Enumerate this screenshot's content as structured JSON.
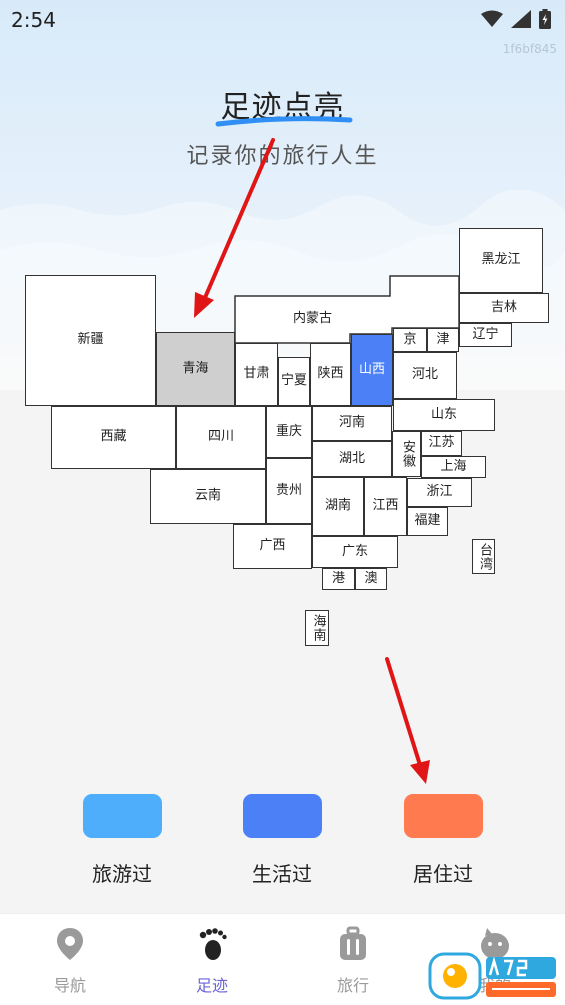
{
  "status": {
    "time": "2:54",
    "device_id": "1f6bf845"
  },
  "header": {
    "title": "足迹点亮",
    "subtitle": "记录你的旅行人生"
  },
  "map": {
    "provinces": {
      "xinjiang": {
        "name": "新疆",
        "state": "none"
      },
      "qinghai": {
        "name": "青海",
        "state": "selected"
      },
      "gansu": {
        "name": "甘肃",
        "state": "none"
      },
      "ningxia": {
        "name": "宁夏",
        "state": "none"
      },
      "shaanxi": {
        "name": "陕西",
        "state": "none"
      },
      "shanxi": {
        "name": "山西",
        "state": "lived"
      },
      "neimenggu": {
        "name": "内蒙古",
        "state": "none"
      },
      "heilongjiang": {
        "name": "黑龙江",
        "state": "none"
      },
      "jilin": {
        "name": "吉林",
        "state": "none"
      },
      "liaoning": {
        "name": "辽宁",
        "state": "none"
      },
      "beijing": {
        "name": "京",
        "state": "none"
      },
      "tianjin": {
        "name": "津",
        "state": "none"
      },
      "hebei": {
        "name": "河北",
        "state": "none"
      },
      "shandong": {
        "name": "山东",
        "state": "none"
      },
      "xizang": {
        "name": "西藏",
        "state": "none"
      },
      "sichuan": {
        "name": "四川",
        "state": "none"
      },
      "chongqing": {
        "name": "重庆",
        "state": "none"
      },
      "henan": {
        "name": "河南",
        "state": "none"
      },
      "anhui": {
        "name": "安徽",
        "state": "none"
      },
      "jiangsu": {
        "name": "江苏",
        "state": "none"
      },
      "shanghai": {
        "name": "上海",
        "state": "none"
      },
      "hubei": {
        "name": "湖北",
        "state": "none"
      },
      "yunnan": {
        "name": "云南",
        "state": "none"
      },
      "guizhou": {
        "name": "贵州",
        "state": "none"
      },
      "hunan": {
        "name": "湖南",
        "state": "none"
      },
      "jiangxi": {
        "name": "江西",
        "state": "none"
      },
      "zhejiang": {
        "name": "浙江",
        "state": "none"
      },
      "fujian": {
        "name": "福建",
        "state": "none"
      },
      "taiwan": {
        "name": "台湾",
        "state": "none"
      },
      "guangxi": {
        "name": "广西",
        "state": "none"
      },
      "guangdong": {
        "name": "广东",
        "state": "none"
      },
      "hongkong": {
        "name": "港",
        "state": "none"
      },
      "macau": {
        "name": "澳",
        "state": "none"
      },
      "hainan": {
        "name": "海南",
        "state": "none"
      }
    }
  },
  "legend": [
    {
      "label": "旅游过",
      "color": "#4faefc"
    },
    {
      "label": "生活过",
      "color": "#4c80f6"
    },
    {
      "label": "居住过",
      "color": "#ff7b4f"
    }
  ],
  "colors": {
    "selected": "#cfcfcf",
    "nav_active": "#6a63d9",
    "nav_inactive": "#9a9a9a",
    "arrow": "#e01515"
  },
  "nav": {
    "items": [
      {
        "label": "导航",
        "icon": "location-pin-icon",
        "active": false
      },
      {
        "label": "足迹",
        "icon": "footprint-icon",
        "active": true
      },
      {
        "label": "旅行",
        "icon": "luggage-icon",
        "active": false
      },
      {
        "label": "我的",
        "icon": "profile-icon",
        "active": false
      }
    ]
  }
}
